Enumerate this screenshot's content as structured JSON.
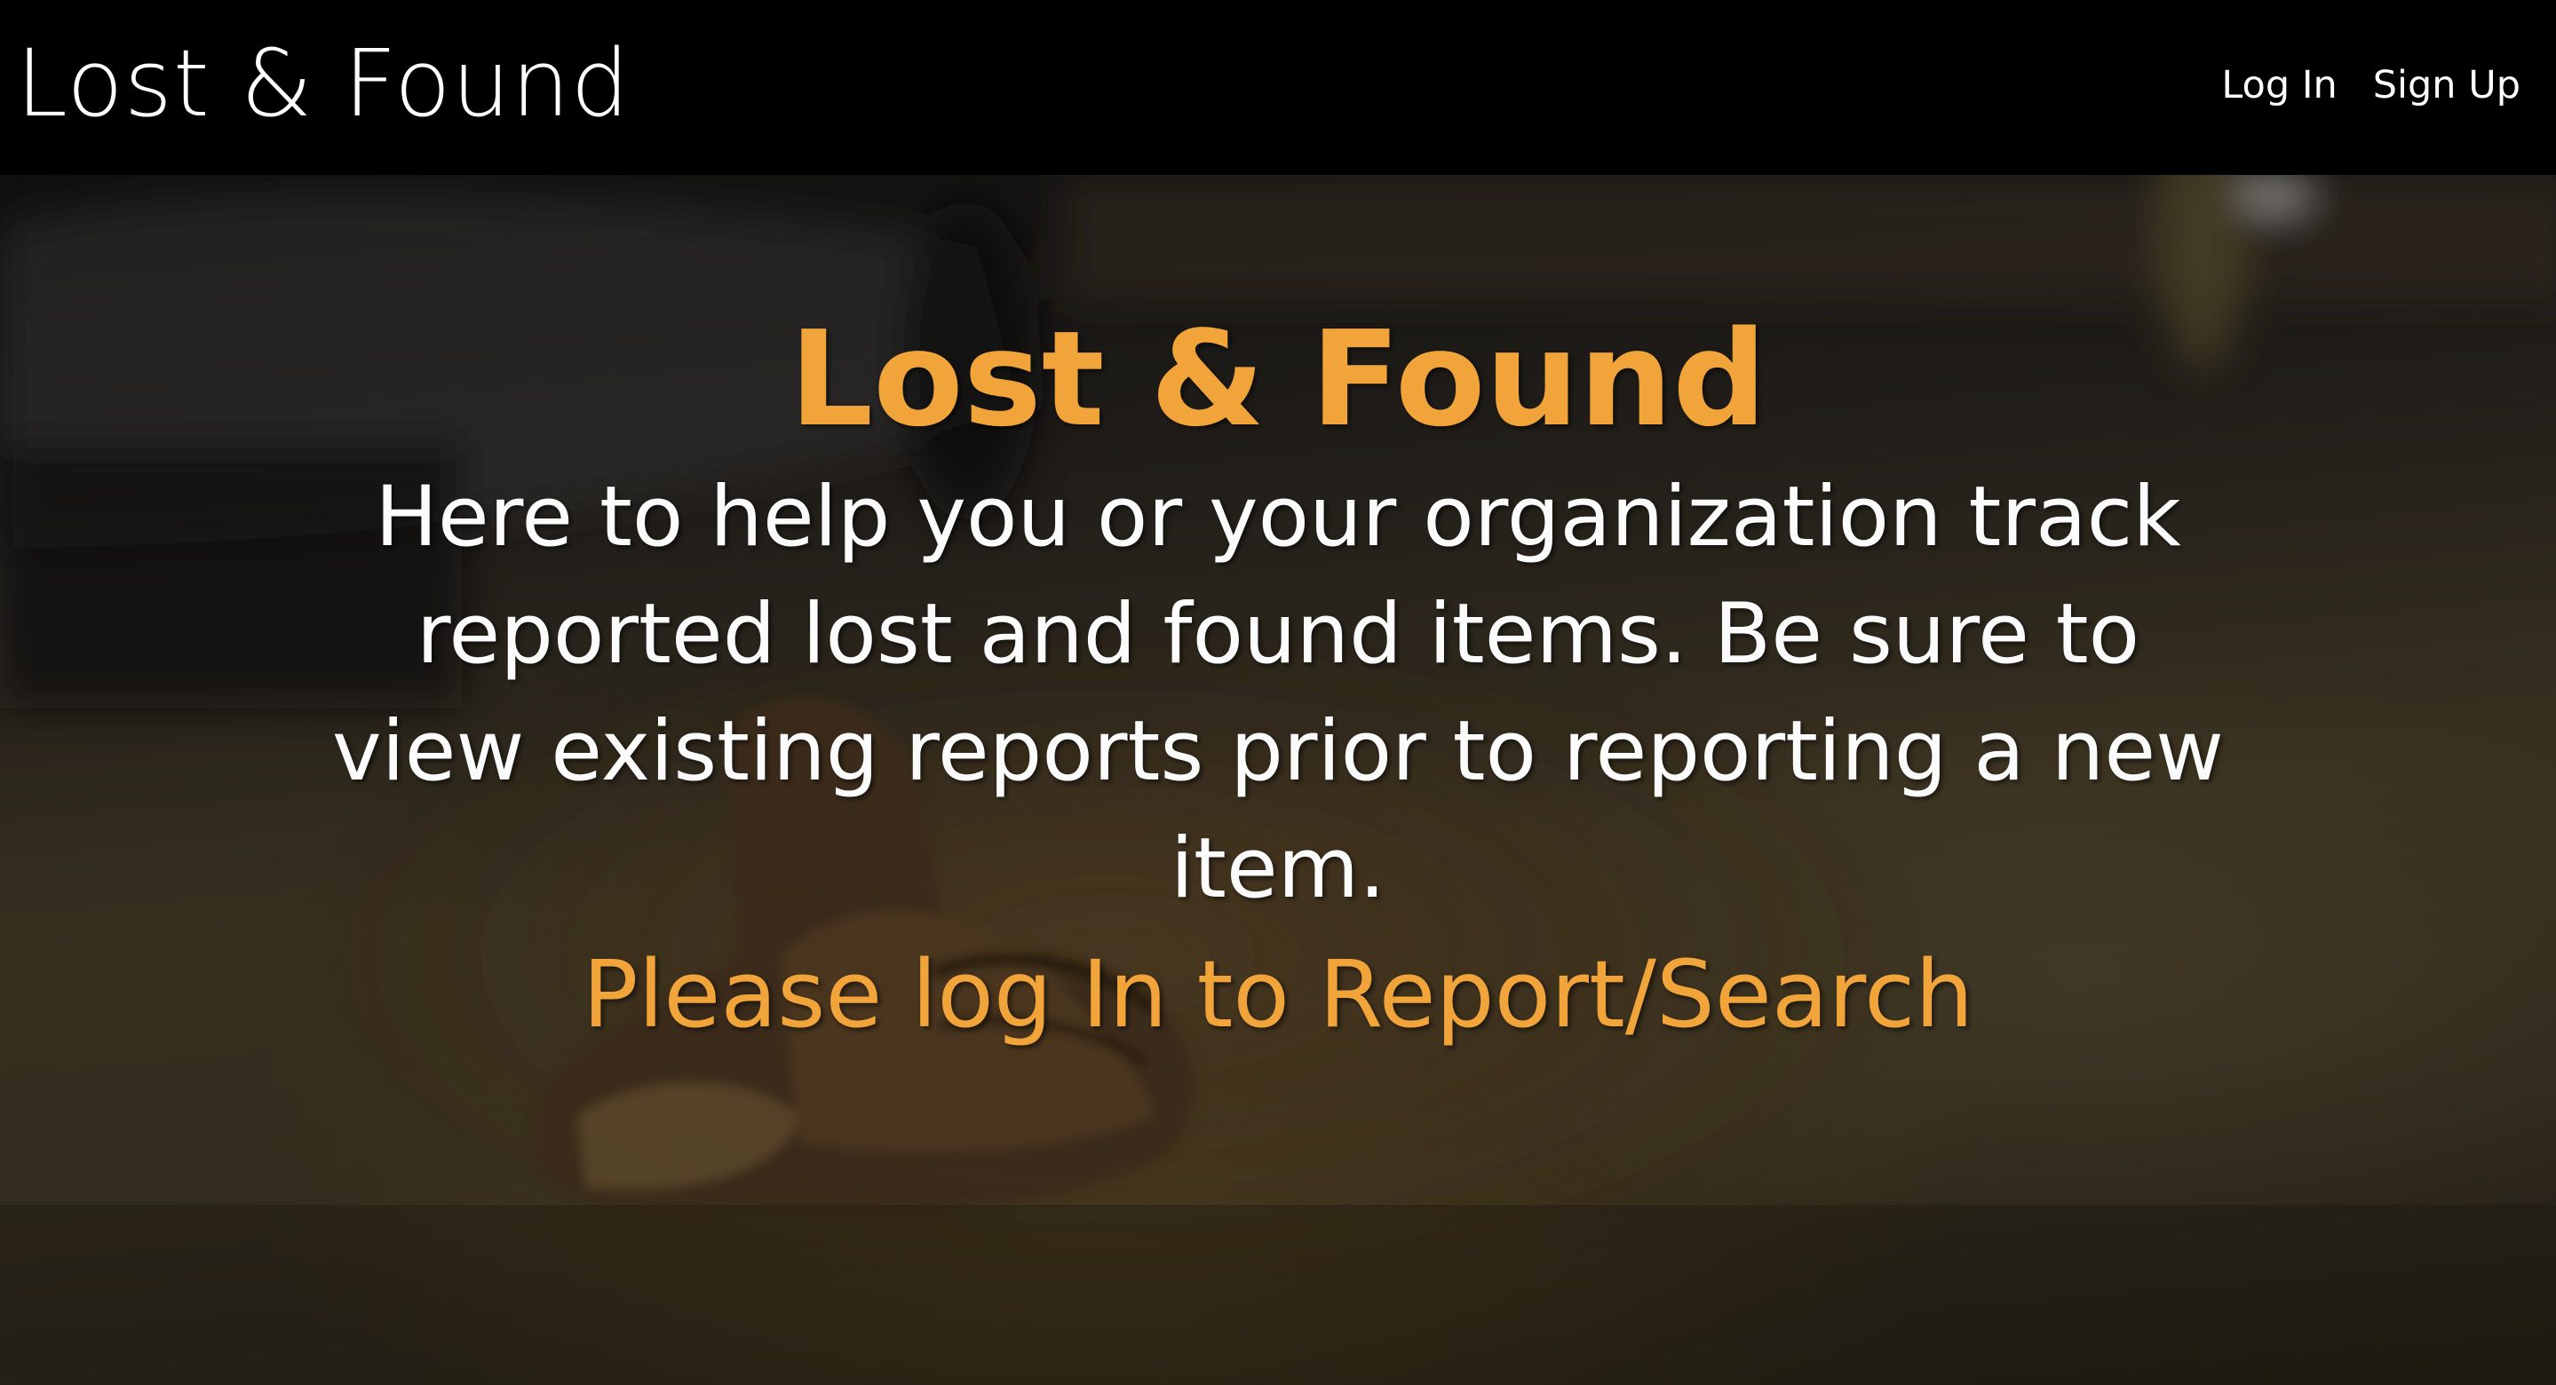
{
  "navbar": {
    "brand": "Lost & Found",
    "links": {
      "login": "Log In",
      "signup": "Sign Up"
    }
  },
  "hero": {
    "title": "Lost & Found",
    "description": "Here to help you or your organization track reported lost and found items. Be sure to view existing reports prior to reporting a new item.",
    "cta": "Please log In to Report/Search",
    "background_image": "old-boot-on-street-photo"
  },
  "colors": {
    "navbar_bg": "#000000",
    "accent": "#f0a43a",
    "text": "#ffffff"
  }
}
